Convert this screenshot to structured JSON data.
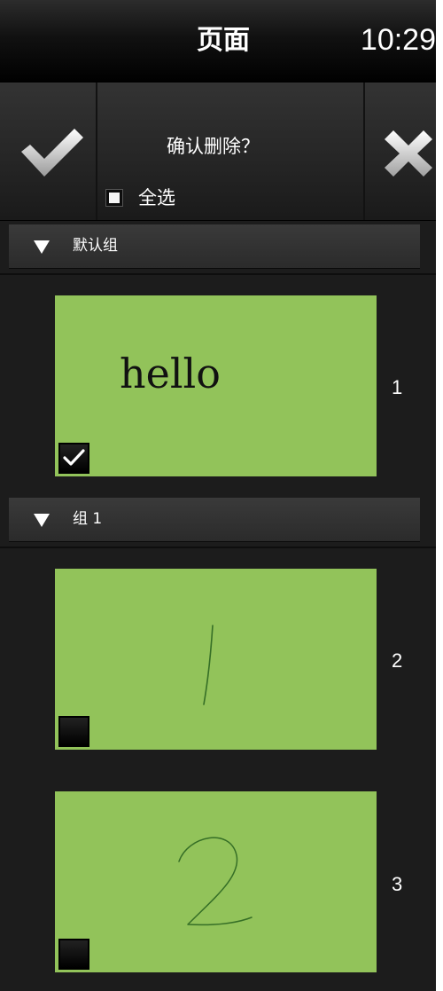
{
  "header": {
    "title": "页面",
    "time": "10:29"
  },
  "actionbar": {
    "confirm_icon": "checkmark-icon",
    "cancel_icon": "close-icon",
    "prompt": "确认删除？",
    "select_all_label": "全选",
    "select_all_checked": false
  },
  "groups": [
    {
      "name": "默认组",
      "pages": [
        {
          "number": "1",
          "content": "hello",
          "checked": true
        }
      ]
    },
    {
      "name": "组 1",
      "pages": [
        {
          "number": "2",
          "content": "/",
          "checked": false
        },
        {
          "number": "3",
          "content": "2",
          "checked": false
        }
      ]
    }
  ],
  "colors": {
    "page_bg": "#92c35a",
    "app_bg": "#1c1c1c"
  }
}
